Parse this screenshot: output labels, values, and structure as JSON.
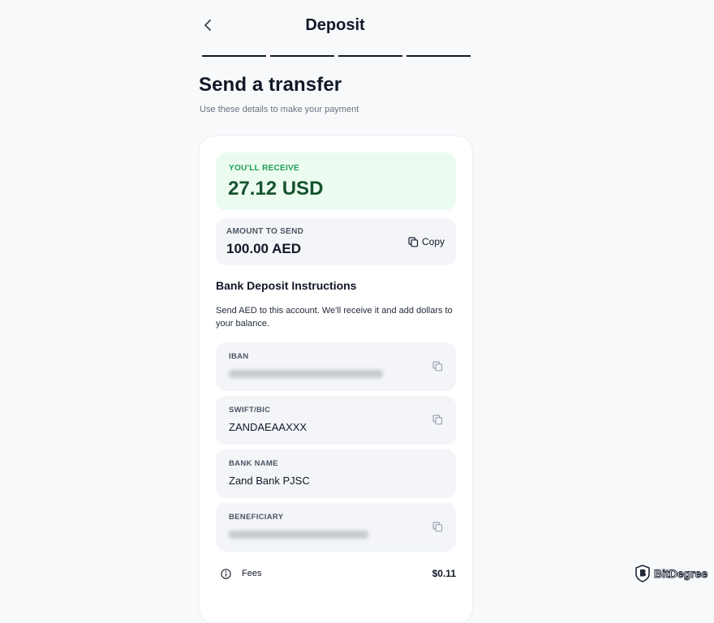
{
  "header": {
    "title": "Deposit",
    "back_icon": "chevron-left-icon",
    "steps": 4
  },
  "page": {
    "heading": "Send a transfer",
    "subheading": "Use these details to make your payment"
  },
  "receive": {
    "label": "YOU'LL RECEIVE",
    "value": "27.12 USD",
    "accent": "#1f9d55"
  },
  "send": {
    "label": "AMOUNT TO SEND",
    "value": "100.00 AED",
    "copy_label": "Copy",
    "copy_icon": "copy-icon"
  },
  "instructions": {
    "title": "Bank Deposit Instructions",
    "text": "Send AED to this account. We'll receive it and add dollars to your balance."
  },
  "fields": [
    {
      "label": "IBAN",
      "redacted": true,
      "copy_icon": "copy-icon"
    },
    {
      "label": "SWIFT/BIC",
      "value": "ZANDAEAAXXX",
      "copy_icon": "copy-icon"
    },
    {
      "label": "BANK NAME",
      "value": "Zand Bank PJSC"
    },
    {
      "label": "BENEFICIARY",
      "redacted": true,
      "copy_icon": "copy-icon"
    }
  ],
  "fees": {
    "label": "Fees",
    "value": "$0.11",
    "icon": "info-icon"
  },
  "watermark": {
    "text": "BitDegree",
    "icon": "bitdegree-logo-icon"
  }
}
